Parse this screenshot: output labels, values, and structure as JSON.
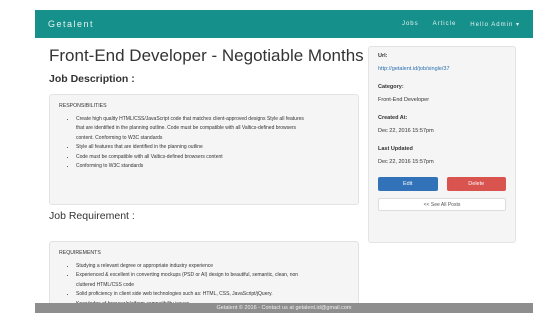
{
  "navbar": {
    "brand": "Getalent",
    "links": [
      "Jobs",
      "Article",
      "Hello Admin ▾"
    ]
  },
  "job": {
    "title": "Front-End Developer - Negotiable Months",
    "description_heading": "Job Description :",
    "responsibilities_caption": "RESPONSIBILITIES",
    "responsibilities": [
      "Create high quality HTML/CSS/JavaScript code that matches client-approved designs Style all features",
      "that are identified in the planning outline. Code must be compatible with all Valtics-defined browsers",
      "content. Conforming to W3C standards",
      "Style all features that are identified in the planning outline",
      "Code must be compatible with all Valtics-defined browsers content",
      "Conforming to W3C standards"
    ],
    "requirement_heading": "Job Requirement :",
    "requirements_caption": "REQUIREMENTS",
    "requirements": [
      "Studying a relevant degree or appropriate industry experience",
      "Experienced & excellent in converting mockups (PSD or AI) design to beautiful, semantic, clean, non",
      "cluttered HTML/CSS code",
      "Solid proficiency in client side web technologies such as: HTML, CSS, JavaScript/jQuery.",
      "Knowledge of browser/platform compatibility issues"
    ]
  },
  "sidebar": {
    "url_label": "Url:",
    "url_value": "http://getalent.id/job/single/37",
    "category_label": "Category:",
    "category_value": "Front-End Developer",
    "created_label": "Created At:",
    "created_value": "Dec 22, 2016 15:57pm",
    "updated_label": "Last Updated",
    "updated_value": "Dec 22, 2016 15:57pm",
    "edit_label": "Edit",
    "delete_label": "Delete",
    "see_all_label": "<< See All Posts"
  },
  "footer": {
    "text": "Getalent © 2016 - Contact us at getalent.id@gmail.com"
  },
  "colors": {
    "navbar": "#15908a",
    "edit_button": "#3172b8",
    "delete_button": "#d9534f",
    "footer": "#8e8e8e"
  }
}
